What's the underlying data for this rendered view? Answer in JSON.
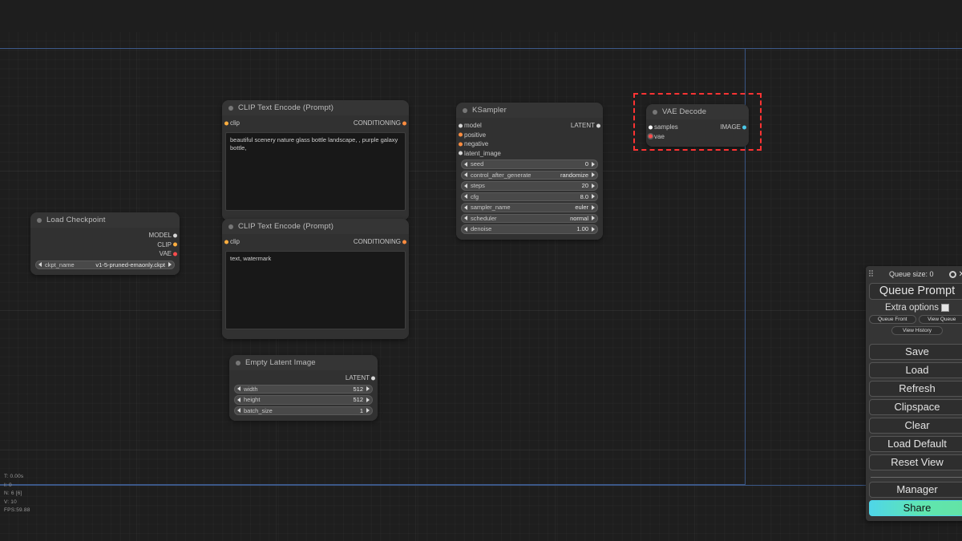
{
  "canvas": {
    "background_color": "#1e1e1e",
    "grid_color": "#2a2a2a",
    "guide_color": "#3d5a8a",
    "selection_color": "#ff3333"
  },
  "nodes": [
    {
      "id": "load-checkpoint",
      "title": "Load Checkpoint",
      "inputs": [],
      "outputs": [
        {
          "label": "MODEL",
          "color": "#d6d6d6"
        },
        {
          "label": "CLIP",
          "color": "#ffae3f"
        },
        {
          "label": "VAE",
          "color": "#ff4d4d"
        }
      ],
      "widgets": [
        {
          "name": "ckpt_name",
          "value": "v1-5-pruned-emaonly.ckpt"
        }
      ]
    },
    {
      "id": "clip-text-encode-positive",
      "title": "CLIP Text Encode (Prompt)",
      "inputs": [
        {
          "label": "clip",
          "color": "#ffae3f"
        }
      ],
      "outputs": [
        {
          "label": "CONDITIONING",
          "color": "#ff8c3f"
        }
      ],
      "text": "beautiful scenery nature glass bottle landscape, , purple galaxy bottle,"
    },
    {
      "id": "clip-text-encode-negative",
      "title": "CLIP Text Encode (Prompt)",
      "inputs": [
        {
          "label": "clip",
          "color": "#ffae3f"
        }
      ],
      "outputs": [
        {
          "label": "CONDITIONING",
          "color": "#ff8c3f"
        }
      ],
      "text": "text, watermark"
    },
    {
      "id": "ksampler",
      "title": "KSampler",
      "inputs": [
        {
          "label": "model",
          "color": "#d6d6d6"
        },
        {
          "label": "positive",
          "color": "#ff8c3f"
        },
        {
          "label": "negative",
          "color": "#ff8c3f"
        },
        {
          "label": "latent_image",
          "color": "#d6d6d6"
        }
      ],
      "outputs": [
        {
          "label": "LATENT",
          "color": "#d6d6d6"
        }
      ],
      "widgets": [
        {
          "name": "seed",
          "value": "0"
        },
        {
          "name": "control_after_generate",
          "value": "randomize"
        },
        {
          "name": "steps",
          "value": "20"
        },
        {
          "name": "cfg",
          "value": "8.0"
        },
        {
          "name": "sampler_name",
          "value": "euler"
        },
        {
          "name": "scheduler",
          "value": "normal"
        },
        {
          "name": "denoise",
          "value": "1.00"
        }
      ]
    },
    {
      "id": "empty-latent-image",
      "title": "Empty Latent Image",
      "inputs": [],
      "outputs": [
        {
          "label": "LATENT",
          "color": "#d6d6d6"
        }
      ],
      "widgets": [
        {
          "name": "width",
          "value": "512"
        },
        {
          "name": "height",
          "value": "512"
        },
        {
          "name": "batch_size",
          "value": "1"
        }
      ]
    },
    {
      "id": "vae-decode",
      "title": "VAE Decode",
      "selected": true,
      "inputs": [
        {
          "label": "samples",
          "color": "#ffffff"
        },
        {
          "label": "vae",
          "color": "#ff4d4d",
          "highlighted": true
        }
      ],
      "outputs": [
        {
          "label": "IMAGE",
          "color": "#4bc8e8"
        }
      ],
      "widgets": []
    }
  ],
  "menu": {
    "queue_size_label": "Queue size: 0",
    "gear_icon": "gear-icon",
    "close_icon": "close-icon",
    "drag_handle_icon": "drag-dots-icon",
    "queue_prompt_label": "Queue Prompt",
    "extra_options_label": "Extra options",
    "extra_options_checked": true,
    "small_buttons": [
      "Queue Front",
      "View Queue"
    ],
    "history_button": "View History",
    "buttons": [
      "Save",
      "Load",
      "Refresh",
      "Clipspace",
      "Clear",
      "Load Default",
      "Reset View"
    ],
    "manager_label": "Manager",
    "share_label": "Share",
    "share_color": "#4fd6e8"
  },
  "stats": {
    "time": "T: 0.00s",
    "iterations": "I: 0",
    "nodes": "N: 6 [6]",
    "version": "V: 10",
    "fps": "FPS:59.88"
  }
}
